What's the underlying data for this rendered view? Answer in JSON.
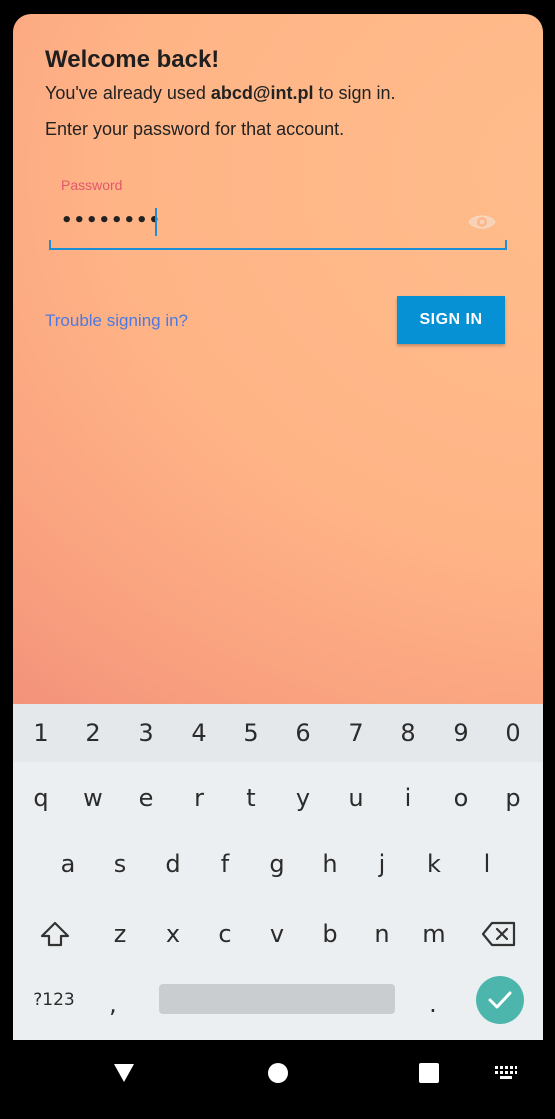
{
  "login": {
    "title": "Welcome back!",
    "line1_prefix": "You've already used ",
    "email": "abcd@int.pl",
    "line1_suffix": " to sign in.",
    "line2": "Enter your password for that account.",
    "password_label": "Password",
    "password_value": "••••••••",
    "password_visibility_icon": "eye-icon",
    "trouble_link": "Trouble signing in?",
    "sign_in_button": "SIGN IN"
  },
  "keyboard": {
    "number_row": [
      "1",
      "2",
      "3",
      "4",
      "5",
      "6",
      "7",
      "8",
      "9",
      "0"
    ],
    "row1": [
      "q",
      "w",
      "e",
      "r",
      "t",
      "y",
      "u",
      "i",
      "o",
      "p"
    ],
    "row2": [
      "a",
      "s",
      "d",
      "f",
      "g",
      "h",
      "j",
      "k",
      "l"
    ],
    "row3": [
      "z",
      "x",
      "c",
      "v",
      "b",
      "n",
      "m"
    ],
    "symbols_key": "?123",
    "comma_key": ",",
    "period_key": ".",
    "shift_icon": "shift-icon",
    "backspace_icon": "backspace-icon",
    "enter_icon": "checkmark-icon"
  },
  "navbar": {
    "back_icon": "back-triangle-icon",
    "home_icon": "home-circle-icon",
    "recents_icon": "recents-square-icon",
    "keyboard_icon": "keyboard-switch-icon"
  },
  "colors": {
    "accent": "#0591d3",
    "link": "#4d79e0",
    "label": "#e2586a",
    "enter_key": "#4db6ac"
  }
}
